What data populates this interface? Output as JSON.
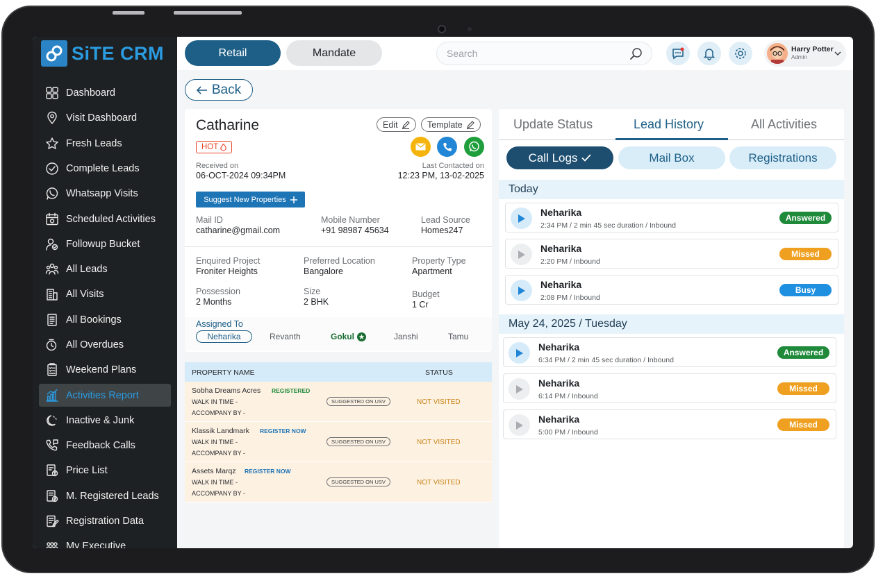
{
  "brand": {
    "name": "SiTE CRM"
  },
  "sidebar": {
    "items": [
      {
        "label": "Dashboard",
        "icon": "grid-icon"
      },
      {
        "label": "Visit Dashboard",
        "icon": "location-pin-icon"
      },
      {
        "label": "Fresh Leads",
        "icon": "star-icon"
      },
      {
        "label": "Complete Leads",
        "icon": "check-circle-icon"
      },
      {
        "label": "Whatsapp Visits",
        "icon": "whatsapp-icon"
      },
      {
        "label": "Scheduled Activities",
        "icon": "calendar-icon"
      },
      {
        "label": "Followup Bucket",
        "icon": "person-follow-icon"
      },
      {
        "label": "All Leads",
        "icon": "people-icon"
      },
      {
        "label": "All Visits",
        "icon": "building-icon"
      },
      {
        "label": "All Bookings",
        "icon": "document-icon"
      },
      {
        "label": "All Overdues",
        "icon": "clock-alert-icon"
      },
      {
        "label": "Weekend Plans",
        "icon": "checklist-icon"
      },
      {
        "label": "Activities Report",
        "icon": "bar-chart-icon"
      },
      {
        "label": "Inactive & Junk",
        "icon": "moon-icon"
      },
      {
        "label": "Feedback Calls",
        "icon": "phone-feedback-icon"
      },
      {
        "label": "Price List",
        "icon": "price-list-icon"
      },
      {
        "label": "M. Registered Leads",
        "icon": "registered-icon"
      },
      {
        "label": "Registration Data",
        "icon": "edit-document-icon"
      },
      {
        "label": "My Executive",
        "icon": "team-icon"
      }
    ],
    "active_index": 12
  },
  "topbar": {
    "retail_label": "Retail",
    "mandate_label": "Mandate",
    "search_placeholder": "Search",
    "user_name": "Harry Potter",
    "user_role": "Admin"
  },
  "back_label": "Back",
  "lead": {
    "name": "Catharine",
    "tag": "HOT",
    "edit_label": "Edit",
    "template_label": "Template",
    "received_label": "Received on",
    "received_value": "06-OCT-2024 09:34PM",
    "last_contacted_label": "Last Contacted on",
    "last_contacted_value": "12:23 PM, 13-02-2025",
    "suggest_label": "Suggest New Properties",
    "mail_label": "Mail ID",
    "mail_value": "catharine@gmail.com",
    "mobile_label": "Mobile Number",
    "mobile_value": "+91 98987 45634",
    "source_label": "Lead Source",
    "source_value": "Homes247",
    "project_label": "Enquired Project",
    "project_value": "Froniter Heights",
    "location_label": "Preferred Location",
    "location_value": "Bangalore",
    "ptype_label": "Property Type",
    "ptype_value": "Apartment",
    "possession_label": "Possession",
    "possession_value": "2 Months",
    "size_label": "Size",
    "size_value": "2 BHK",
    "budget_label": "Budget",
    "budget_value": "1 Cr",
    "assigned_label": "Assigned To",
    "assignees": [
      "Neharika",
      "Revanth",
      "Gokul",
      "Janshi",
      "Tamu"
    ]
  },
  "properties": {
    "col_name": "PROPERTY NAME",
    "col_status": "STATUS",
    "walk_label": "WALK IN TIME -",
    "accompany_label": "ACCOMPANY BY -",
    "suggested_label": "SUGGESTED ON USV",
    "rows": [
      {
        "name": "Sobha Dreams Acres",
        "tag": "REGISTERED",
        "status": "NOT VISITED"
      },
      {
        "name": "Klassik Landmark",
        "tag": "REGISTER NOW",
        "status": "NOT VISITED"
      },
      {
        "name": "Assets Marqz",
        "tag": "REGISTER NOW",
        "status": "NOT VISITED"
      }
    ]
  },
  "right": {
    "tabs": [
      "Update Status",
      "Lead History",
      "All Activities"
    ],
    "active_tab": "Lead History",
    "subtabs": [
      "Call Logs",
      "Mail Box",
      "Registrations"
    ],
    "sections": [
      {
        "title": "Today",
        "calls": [
          {
            "caller": "Neharika",
            "desc": "2:34 PM / 2 min 45 sec duration / Inbound",
            "status": "Answered"
          },
          {
            "caller": "Neharika",
            "desc": "2:20 PM / Inbound",
            "status": "Missed"
          },
          {
            "caller": "Neharika",
            "desc": "2:08 PM / Inbound",
            "status": "Busy"
          }
        ]
      },
      {
        "title": "May 24, 2025 / Tuesday",
        "calls": [
          {
            "caller": "Neharika",
            "desc": "6:34 PM / 2 min 45 sec duration / Inbound",
            "status": "Answered"
          },
          {
            "caller": "Neharika",
            "desc": "6:14 PM / Inbound",
            "status": "Missed"
          },
          {
            "caller": "Neharika",
            "desc": "5:00 PM / Inbound",
            "status": "Missed"
          }
        ]
      }
    ]
  },
  "colors": {
    "primary": "#1e5f87",
    "accent": "#2a9be0",
    "answered": "#1e8a3a",
    "missed": "#f0a020",
    "busy": "#1f8fe0",
    "hot": "#e8472a",
    "sidebar_bg": "#1e2123"
  }
}
